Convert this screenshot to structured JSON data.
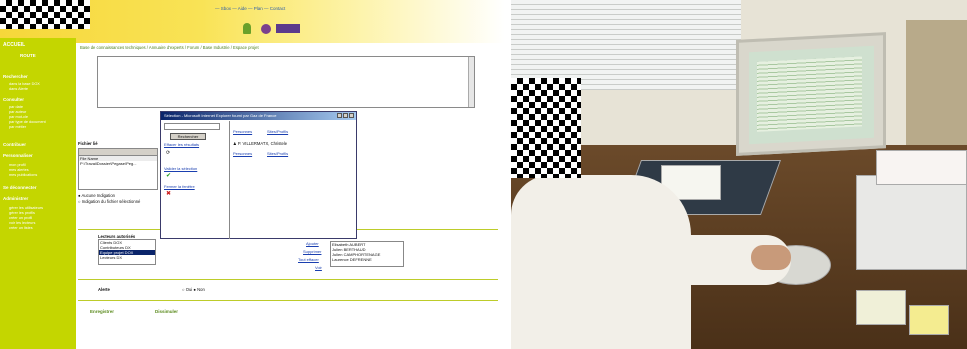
{
  "left_screen": {
    "topnav": "— Sbox — Aide — Plan — Contact",
    "breadcrumb": "Base de connaissances techniques  /  Annuaire d'experts  /  Forum  /  Base Industrie  /  Espace projet",
    "sidebar": {
      "home": "ACCUEIL",
      "home_sub": "ROUTE",
      "sections": [
        {
          "title": "Rechercher",
          "items": [
            "dans la base DOX",
            "dans Alerte"
          ]
        },
        {
          "title": "Consulter",
          "items": [
            "par date",
            "par auteur",
            "par mot-cle",
            "par type de document",
            "par métier"
          ]
        },
        {
          "title": "Contribuer",
          "items": []
        },
        {
          "title": "Personnaliser",
          "items": [
            "mon profil",
            "mes alertes",
            "mes publications"
          ]
        },
        {
          "title": "Se déconnecter",
          "items": []
        },
        {
          "title": "Administrer",
          "items": [
            "gérer les utilisateurs",
            "gérer les profils",
            "créer un profil",
            "voir les lecteurs",
            "créer un listes"
          ]
        }
      ]
    },
    "fichier_lie_label": "Fichier lié",
    "file_name_header": "File Name",
    "file_path": "P:\\TravailDossier\\Pegase\\Peg...",
    "radio_aucune": "Aucune Indigation",
    "radio_fichier": "Indigation du fichier sélectionné",
    "lecteurs_title": "Lecteurs autorisés",
    "lecteurs_list": [
      "Clients DOX",
      "Contributeurs DX",
      "Equipe projet DOX",
      "Lecteurs DX"
    ],
    "lecteurs_selected_index": 2,
    "action_ajouter": "Ajouter",
    "action_supprimer": "Supprimer",
    "action_tout_effacer": "Tout effacer",
    "action_voir": "Voir",
    "people_list": [
      "Elisabeth AUBERT",
      "Julien BERTHAUD",
      "Julien CAMPHORTENAGE",
      "Laurence DEFRENNE"
    ],
    "alerte_label": "Alerte",
    "alerte_oui": "Oui",
    "alerte_non": "Non",
    "btn_enregistrer": "Enregistrer",
    "btn_dissimuler": "Dissimuler"
  },
  "dialog": {
    "title": "Sélection - Microsoft Internet Explorer fourni par Gaz de France",
    "search_button": "Rechercher",
    "effacer": "Effacer les résultats",
    "valider": "Valider la sélection",
    "fermer": "Fermer la fenêtre",
    "personnes": "Personnes",
    "sites": "Sites/Profils",
    "result": "P. VILLERMATX, Christele",
    "personnes2": "Personnes",
    "sites2": "Sites/Profils"
  },
  "colors": {
    "sidebar": "#c4d600",
    "banner": "#f6d73a",
    "link": "#1a3fb0",
    "title_bar": "#0a246a"
  }
}
